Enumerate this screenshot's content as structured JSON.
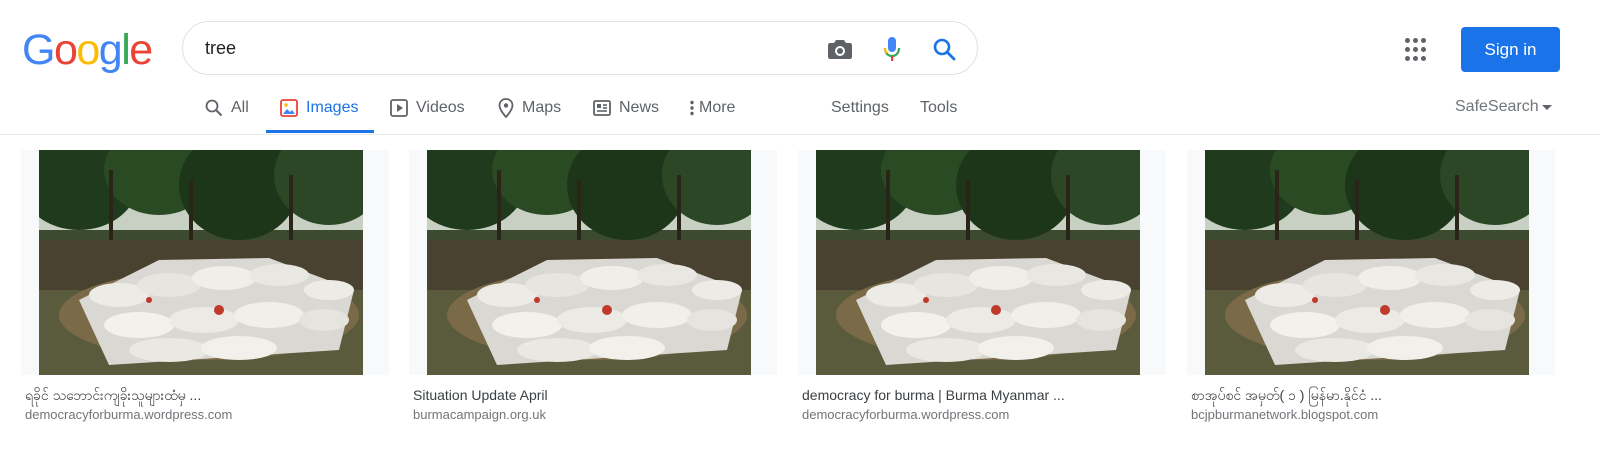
{
  "logo": {
    "letters": [
      {
        "ch": "G",
        "color": "#4285f4"
      },
      {
        "ch": "o",
        "color": "#ea4335"
      },
      {
        "ch": "o",
        "color": "#fbbc05"
      },
      {
        "ch": "g",
        "color": "#4285f4"
      },
      {
        "ch": "l",
        "color": "#34a853"
      },
      {
        "ch": "e",
        "color": "#ea4335"
      }
    ]
  },
  "search": {
    "query": "tree"
  },
  "header": {
    "signin_label": "Sign in"
  },
  "tabs": [
    {
      "label": "All",
      "icon": "search-icon",
      "active": false
    },
    {
      "label": "Images",
      "icon": "image-icon",
      "active": true
    },
    {
      "label": "Videos",
      "icon": "video-icon",
      "active": false
    },
    {
      "label": "Maps",
      "icon": "map-pin-icon",
      "active": false
    },
    {
      "label": "News",
      "icon": "news-icon",
      "active": false
    },
    {
      "label": "More",
      "icon": "more-vertical-icon",
      "active": false
    },
    {
      "label": "Settings",
      "active": false
    },
    {
      "label": "Tools",
      "active": false
    }
  ],
  "safesearch": {
    "label": "SafeSearch"
  },
  "results": [
    {
      "title": "ရခိုင် သဘောင်းကျခိုးသူများထံမှ ...",
      "site": "democracyforburma.wordpress.com"
    },
    {
      "title": "Situation Update April",
      "site": "burmacampaign.org.uk"
    },
    {
      "title": "democracy for burma | Burma Myanmar ...",
      "site": "democracyforburma.wordpress.com"
    },
    {
      "title": "စာအုပ်စင် အမှတ်( ၁ ) မြန်မာ.နိုင်ငံ ...",
      "site": "bcjpburmanetwork.blogspot.com"
    }
  ],
  "colors": {
    "accent": "#1a73e8",
    "text_secondary": "#5f6368"
  }
}
